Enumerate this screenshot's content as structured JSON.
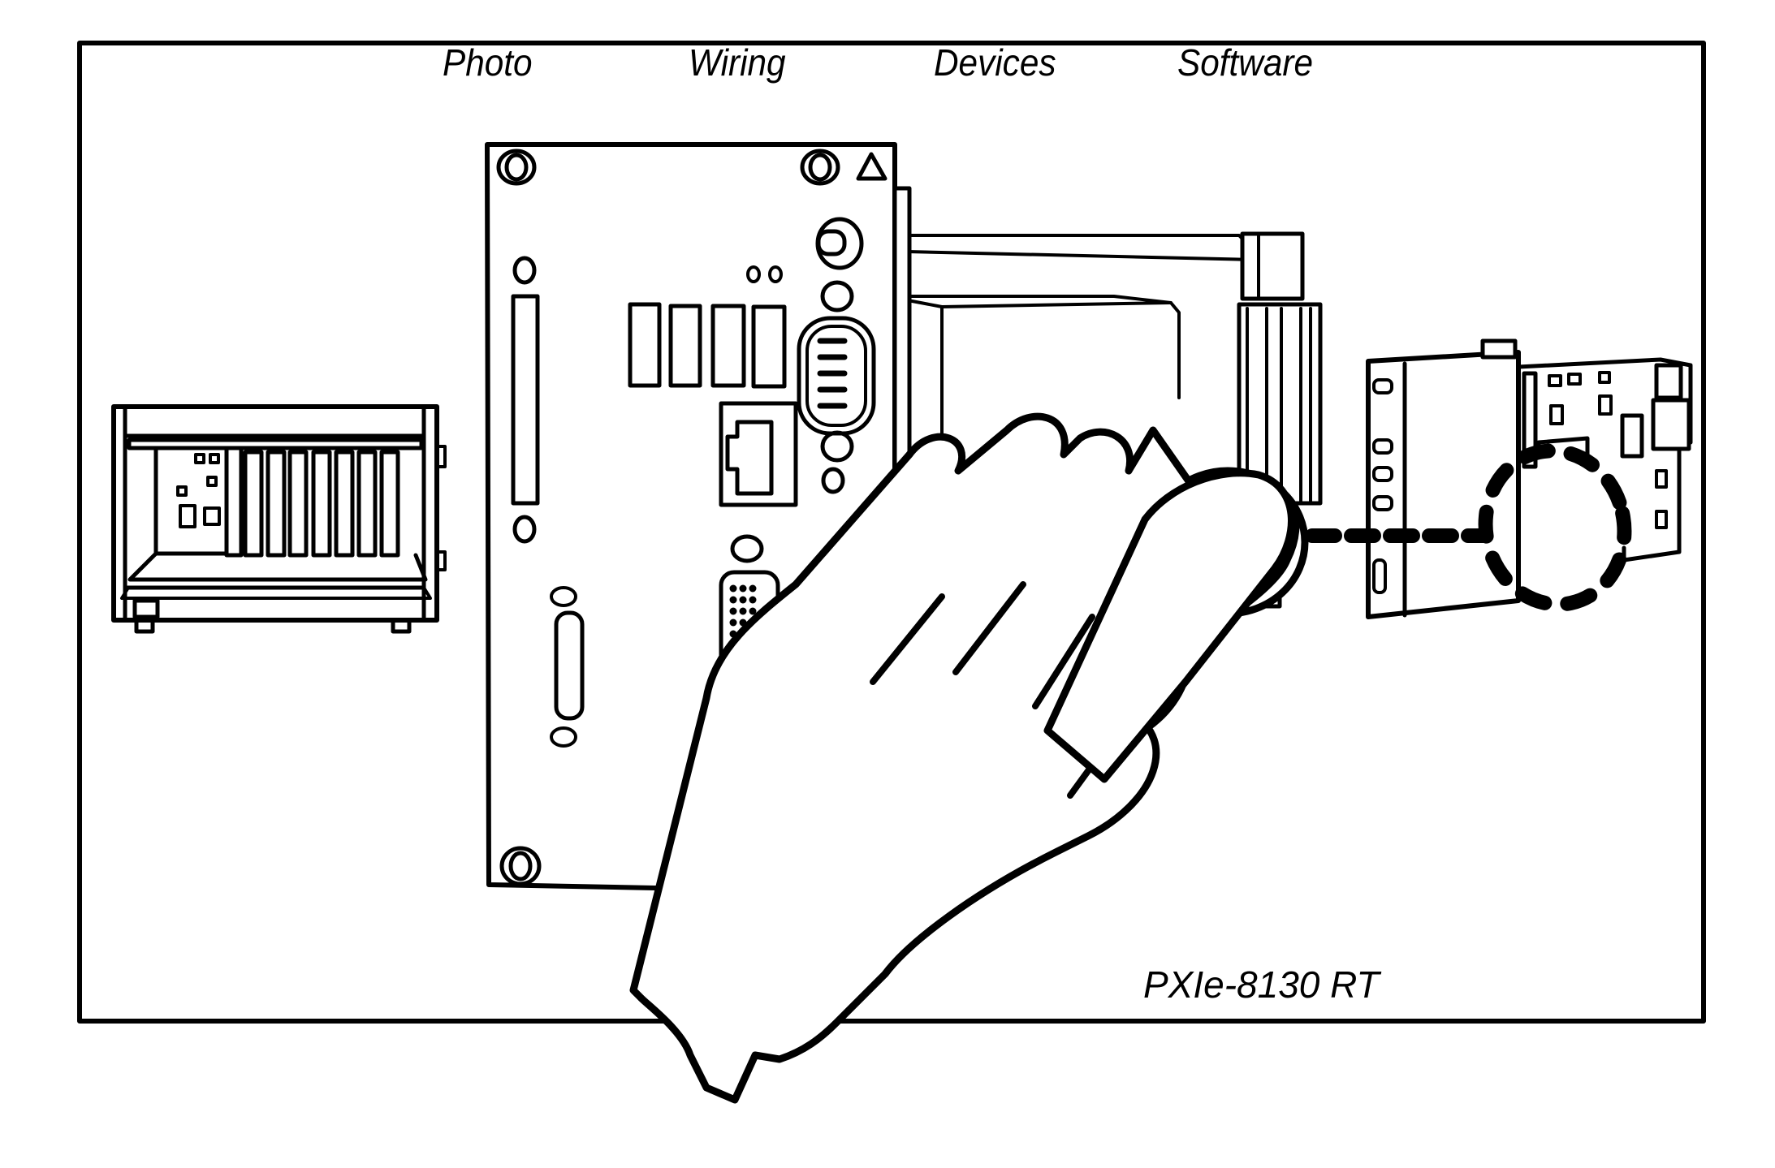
{
  "nav": {
    "tabs": [
      {
        "label": "Photo"
      },
      {
        "label": "Wiring"
      },
      {
        "label": "Devices"
      },
      {
        "label": "Software"
      }
    ]
  },
  "diagram": {
    "model_label": "PXIe-8130 RT",
    "elements": {
      "chassis": "pxi-chassis-icon",
      "controller": "controller-front-panel",
      "module": "expansion-card",
      "hand": "hand-pointer-icon"
    },
    "colors": {
      "line": "#000000",
      "background": "#ffffff"
    }
  }
}
